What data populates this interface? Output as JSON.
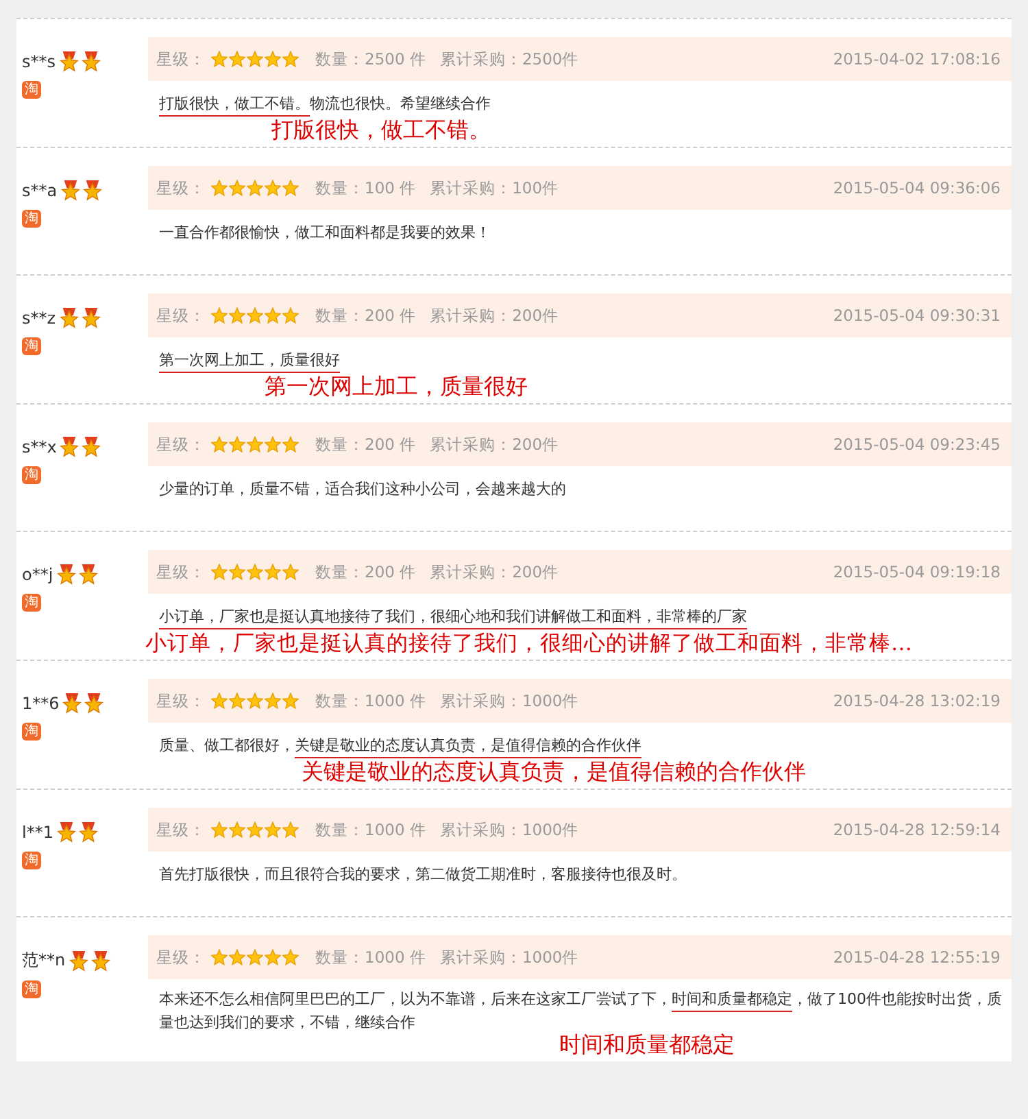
{
  "reviews": [
    {
      "user": "s**s",
      "badge": "淘",
      "rating_label": "星级：",
      "stars": 5,
      "quantity": "数量：2500 件",
      "total": "累计采购：2500件",
      "date": "2015-04-02 17:08:16",
      "comment": [
        {
          "text": "打版很快，做工不错。",
          "underlined": true
        },
        {
          "text": "物流也很快。希望继续合作",
          "underlined": false
        }
      ],
      "annotation": "打版很快，做工不错。"
    },
    {
      "user": "s**a",
      "badge": "淘",
      "rating_label": "星级：",
      "stars": 5,
      "quantity": "数量：100 件",
      "total": "累计采购：100件",
      "date": "2015-05-04 09:36:06",
      "comment": [
        {
          "text": "一直合作都很愉快，做工和面料都是我要的效果！",
          "underlined": false
        }
      ]
    },
    {
      "user": "s**z",
      "badge": "淘",
      "rating_label": "星级：",
      "stars": 5,
      "quantity": "数量：200 件",
      "total": "累计采购：200件",
      "date": "2015-05-04 09:30:31",
      "comment": [
        {
          "text": "第一次网上加工，质量很好",
          "underlined": true
        }
      ],
      "annotation": "第一次网上加工，质量很好"
    },
    {
      "user": "s**x",
      "badge": "淘",
      "rating_label": "星级：",
      "stars": 5,
      "quantity": "数量：200 件",
      "total": "累计采购：200件",
      "date": "2015-05-04 09:23:45",
      "comment": [
        {
          "text": "少量的订单，质量不错，适合我们这种小公司，会越来越大的",
          "underlined": false
        }
      ]
    },
    {
      "user": "o**j",
      "badge": "淘",
      "rating_label": "星级：",
      "stars": 5,
      "quantity": "数量：200 件",
      "total": "累计采购：200件",
      "date": "2015-05-04 09:19:18",
      "comment": [
        {
          "text": "小订单，厂家也是挺认真地接待了我们，很细心地和我们讲解做工和面料，非常棒的厂家",
          "underlined": true
        }
      ],
      "annotation": "小订单，厂家也是挺认真的接待了我们，很细心的讲解了做工和面料，非常棒…"
    },
    {
      "user": "1**6",
      "badge": "淘",
      "rating_label": "星级：",
      "stars": 5,
      "quantity": "数量：1000 件",
      "total": "累计采购：1000件",
      "date": "2015-04-28 13:02:19",
      "comment": [
        {
          "text": "质量、做工都很好，",
          "underlined": false
        },
        {
          "text": "关键是敬业的态度认真负责，是值得信赖的合作伙伴",
          "underlined": true
        }
      ],
      "annotation": "关键是敬业的态度认真负责，是值得信赖的合作伙伴"
    },
    {
      "user": "l**1",
      "badge": "淘",
      "rating_label": "星级：",
      "stars": 5,
      "quantity": "数量：1000 件",
      "total": "累计采购：1000件",
      "date": "2015-04-28 12:59:14",
      "comment": [
        {
          "text": "首先打版很快，而且很符合我的要求，第二做货工期准时，客服接待也很及时。",
          "underlined": false
        }
      ]
    },
    {
      "user": "范**n",
      "badge": "淘",
      "rating_label": "星级：",
      "stars": 5,
      "quantity": "数量：1000 件",
      "total": "累计采购：1000件",
      "date": "2015-04-28 12:55:19",
      "comment": [
        {
          "text": "本来还不怎么相信阿里巴巴的工厂，以为不靠谱，后来在这家工厂尝试了下，",
          "underlined": false
        },
        {
          "text": "时间和质量都稳定",
          "underlined": true
        },
        {
          "text": "，做了100件也能按时出货，质量也达到我们的要求，不错，继续合作",
          "underlined": false
        }
      ],
      "annotation": "时间和质量都稳定"
    }
  ]
}
